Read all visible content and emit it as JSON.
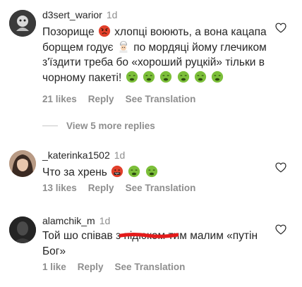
{
  "comments": [
    {
      "username": "d3sert_warior",
      "time": "1d",
      "text_parts": [
        "Позорище",
        "хлопці воюють, а вона кацапа борщем годує",
        "по мордяці йому глечиком з'їздити треба бо «хороший руцкій» тільки в чорному пакеті!"
      ],
      "likes": "21 likes",
      "reply": "Reply",
      "translation": "See Translation"
    },
    {
      "username": "_katerinka1502",
      "time": "1d",
      "text": "Что за хрень",
      "likes": "13 likes",
      "reply": "Reply",
      "translation": "See Translation"
    },
    {
      "username": "alamchik_m",
      "time": "1d",
      "text_parts": [
        "Той шо співав з",
        "пі",
        "дюком",
        "тим малим «путін Бог»"
      ],
      "likes": "1 like",
      "reply": "Reply",
      "translation": "See Translation"
    }
  ],
  "view_more": "View 5 more replies",
  "icons": [
    "heart-icon",
    "angry-face-emoji",
    "man-cook-emoji",
    "nauseated-face-emoji",
    "cursing-face-emoji"
  ],
  "colors": {
    "text": "#262626",
    "muted": "#8e8e8e",
    "redact": "#e41b1b"
  }
}
